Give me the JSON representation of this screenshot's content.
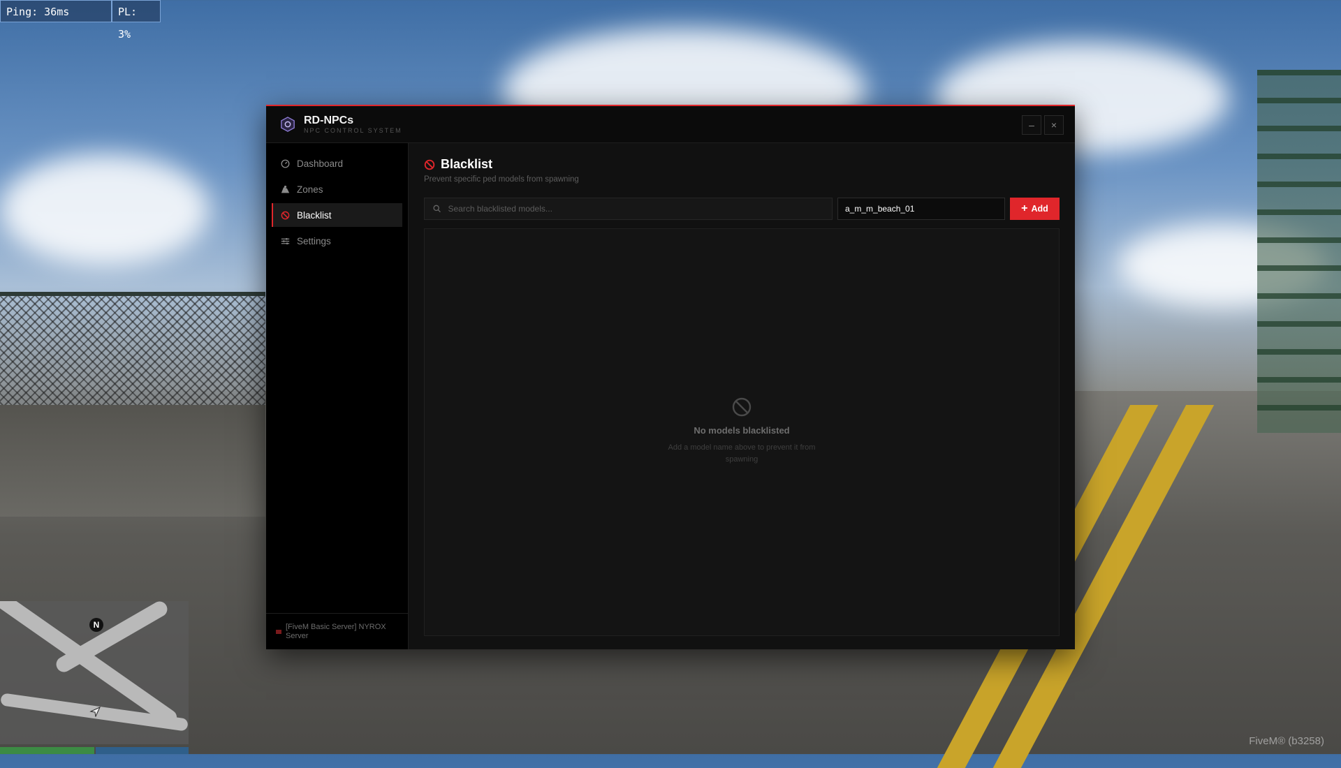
{
  "hud": {
    "ping": "Ping: 36ms",
    "packet_loss": "PL: 3%",
    "compass": "N",
    "client_tag": "FiveM® (b3258)"
  },
  "app": {
    "title": "RD-NPCs",
    "subtitle": "NPC CONTROL SYSTEM",
    "accent_color": "#e0262b"
  },
  "window_controls": {
    "minimize_icon": "–",
    "close_icon": "×"
  },
  "sidebar": {
    "items": [
      {
        "label": "Dashboard",
        "icon": "dashboard-icon"
      },
      {
        "label": "Zones",
        "icon": "zones-icon"
      },
      {
        "label": "Blacklist",
        "icon": "ban-icon",
        "active": true
      },
      {
        "label": "Settings",
        "icon": "sliders-icon"
      }
    ],
    "server_name": "[FiveM Basic Server] NYROX Server"
  },
  "page": {
    "title": "Blacklist",
    "subtitle": "Prevent specific ped models from spawning",
    "search_placeholder": "Search blacklisted models...",
    "model_input_value": "a_m_m_beach_01",
    "add_label": "Add",
    "empty_title": "No models blacklisted",
    "empty_description": "Add a model name above to prevent it from spawning"
  }
}
